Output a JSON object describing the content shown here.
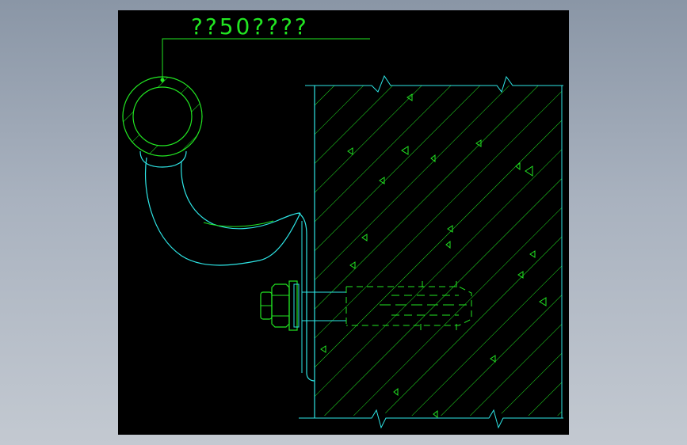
{
  "drawing": {
    "label_text": "??50????",
    "colors": {
      "background": "#000000",
      "green": "#22e622",
      "cyan": "#2ee6e6",
      "canvas_border": "#ffffff"
    }
  }
}
